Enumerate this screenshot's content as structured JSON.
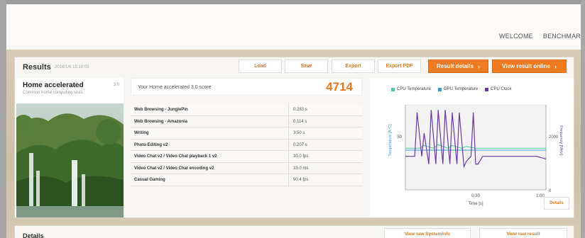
{
  "header": {
    "welcome": "WELCOME",
    "user": "BENCHMAR"
  },
  "results": {
    "title": "Results",
    "date": "2016/1/6 15:10:03",
    "buttons": {
      "load": "Load",
      "save": "Save",
      "export": "Export",
      "export_pdf": "Export PDF",
      "result_details": "Result details",
      "view_online": "View result online"
    }
  },
  "test": {
    "name": "Home accelerated",
    "subtitle": "Common home computing tests",
    "version": "3.0",
    "score_label": "Your Home accelerated 3.0 score",
    "score": "4714"
  },
  "subtests": [
    {
      "name": "Web Browsing - JunglePin",
      "value": "0.283 s"
    },
    {
      "name": "Web Browsing - Amazonia",
      "value": "0.114 s"
    },
    {
      "name": "Writing",
      "value": "3.50 s"
    },
    {
      "name": "Photo Editing v2",
      "value": "0.207 s"
    },
    {
      "name": "Video Chat v2 / Video Chat playback 1 v2",
      "value": "30.0 fps"
    },
    {
      "name": "Video Chat v2 / Video Chat encoding v2",
      "value": "33.0 ms"
    },
    {
      "name": "Casual Gaming",
      "value": "90.4 fps"
    }
  ],
  "chart_data": {
    "type": "line",
    "legend": [
      "CPU Temperature",
      "GPU Temperature",
      "CPU Clock"
    ],
    "colors": {
      "cpu_temp": "#4cc9a6",
      "gpu_temp": "#3a9ad8",
      "cpu_clock": "#6a3aa0"
    },
    "xlabel": "Time [s]",
    "ylabel_left": "Temperature [A°C]",
    "ylabel_right": "Frequency [MHz]",
    "x_ticks": [
      "0:30",
      "1:00"
    ],
    "y_left_ticks": [
      "50"
    ],
    "y_right_ticks": [
      "2000",
      "0"
    ],
    "x_range": [
      0,
      60
    ],
    "series": [
      {
        "name": "CPU Temperature",
        "x": [
          0,
          6,
          8,
          12,
          14,
          18,
          20,
          24,
          26,
          30,
          34,
          40,
          50,
          60
        ],
        "values": [
          44,
          44,
          47,
          44,
          48,
          44,
          47,
          44,
          46,
          44,
          44,
          44,
          44,
          44
        ]
      },
      {
        "name": "GPU Temperature",
        "x": [
          0,
          10,
          20,
          30,
          40,
          50,
          60
        ],
        "values": [
          42,
          42,
          42,
          42,
          42,
          42,
          42
        ]
      },
      {
        "name": "CPU Clock",
        "x": [
          0,
          4,
          5,
          7,
          8,
          10,
          11,
          13,
          14,
          16,
          17,
          19,
          20,
          22,
          23,
          25,
          26,
          28,
          29,
          30,
          31,
          33,
          35,
          40,
          48,
          52,
          56,
          60
        ],
        "values": [
          1300,
          1300,
          3000,
          1300,
          2200,
          1000,
          3100,
          1000,
          3100,
          1000,
          3100,
          1000,
          3000,
          1000,
          3000,
          900,
          1100,
          1300,
          3000,
          1000,
          1000,
          1300,
          1300,
          1300,
          1300,
          1300,
          1300,
          1200
        ]
      }
    ]
  },
  "chart_ui": {
    "details_label": "Details"
  },
  "details": {
    "title": "Details",
    "raw_sysinfo": "View raw SystemInfo",
    "raw_result": "View raw result"
  }
}
